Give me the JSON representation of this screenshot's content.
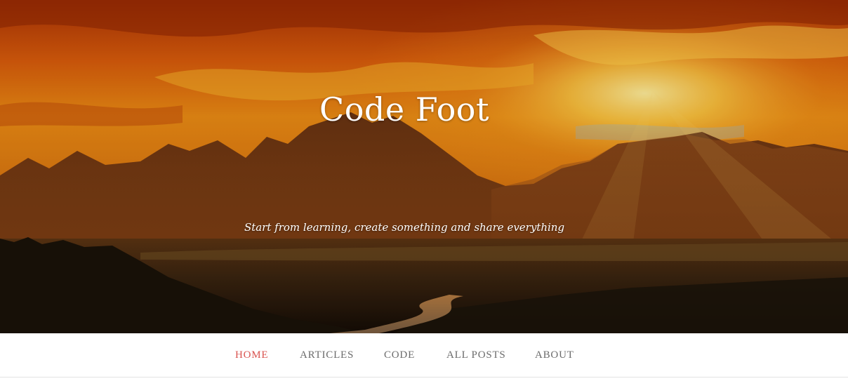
{
  "site": {
    "title": "Code Foot",
    "tagline": "Start from learning, create something and share everything"
  },
  "hero": {
    "background_image": "mountain-sunset-landscape"
  },
  "nav": {
    "items": [
      {
        "label": "HOME",
        "active": true
      },
      {
        "label": "ARTICLES",
        "active": false
      },
      {
        "label": "CODE",
        "active": false
      },
      {
        "label": "ALL POSTS",
        "active": false
      },
      {
        "label": "ABOUT",
        "active": false
      }
    ],
    "active_color": "#d9534f",
    "inactive_color": "#6b6b6b"
  }
}
